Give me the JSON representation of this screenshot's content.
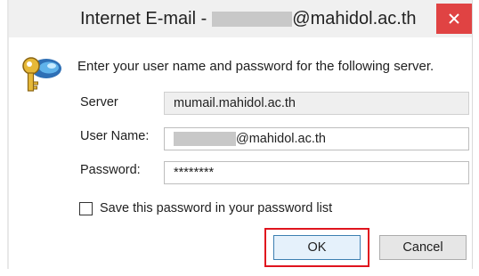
{
  "window": {
    "title_prefix": "Internet E-mail - ",
    "title_suffix": "@mahidol.ac.th",
    "close_glyph": "✕"
  },
  "instructions": "Enter your user name and password for the following server.",
  "fields": {
    "server": {
      "label": "Server",
      "value": "mumail.mahidol.ac.th"
    },
    "user_name": {
      "label": "User Name:",
      "value_suffix": "@mahidol.ac.th"
    },
    "password": {
      "label": "Password:",
      "value": "********"
    }
  },
  "save_password_label": "Save this password in your password list",
  "save_password_checked": false,
  "buttons": {
    "ok": "OK",
    "cancel": "Cancel"
  },
  "icons": {
    "dialog_icon": "key-icon",
    "close": "close-icon"
  },
  "colors": {
    "close_button": "#e04343",
    "highlight": "#e0141e",
    "default_button_border": "#3c7fb1"
  }
}
